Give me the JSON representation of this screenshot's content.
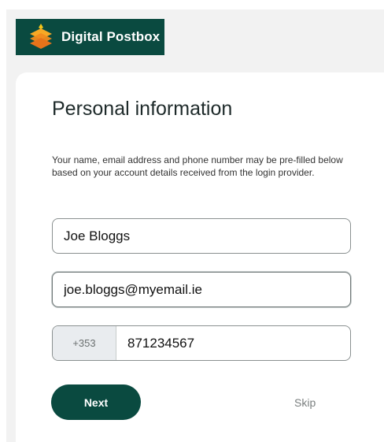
{
  "header": {
    "brand_name": "Digital Postbox",
    "logo_colors": {
      "top": "#f5a623",
      "middle": "#f28b1e",
      "bottom": "#e8731a"
    }
  },
  "form": {
    "title": "Personal information",
    "description": "Your name, email address and phone number may be pre-filled below based on your account details received from the login provider.",
    "name_value": "Joe Bloggs",
    "email_value": "joe.bloggs@myemail.ie",
    "phone_prefix": "+353",
    "phone_value": "871234567",
    "next_label": "Next",
    "skip_label": "Skip"
  },
  "colors": {
    "brand": "#0a4a40",
    "background": "#f2f2f2"
  }
}
